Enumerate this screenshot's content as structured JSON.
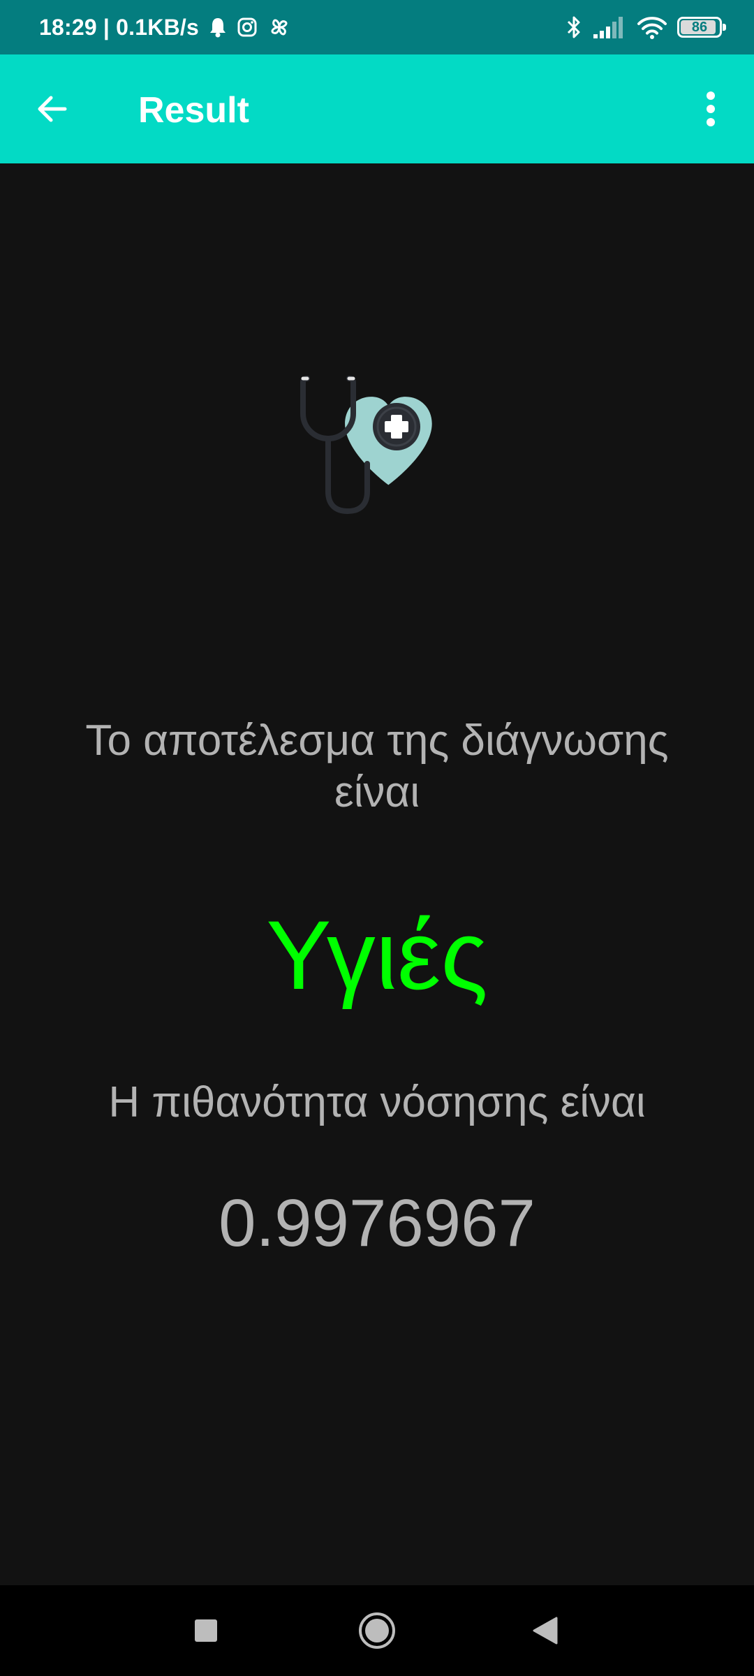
{
  "status_bar": {
    "time": "18:29 | 0.1KB/s",
    "battery": "86",
    "battery_level": 0.86,
    "icons": [
      "bell-icon",
      "instagram-icon",
      "pinwheel-icon",
      "bluetooth-icon",
      "signal-icon",
      "wifi-icon",
      "battery-icon"
    ]
  },
  "app_bar": {
    "title": "Result",
    "back_icon": "arrow-left-icon",
    "menu_icon": "more-vert-icon",
    "background": "#03dac5"
  },
  "content": {
    "diagnosis_label": "Το αποτέλεσμα της διάγνωσης είναι",
    "diagnosis_result": "Υγιές",
    "probability_label": "Η πιθανότητα νόσησης είναι",
    "probability_value": "0.9976967",
    "result_color": "#00ff00",
    "logo": "stethoscope-heart-icon"
  },
  "nav_bar": {
    "buttons": [
      "recents-square-icon",
      "home-circle-icon",
      "back-triangle-icon"
    ]
  }
}
